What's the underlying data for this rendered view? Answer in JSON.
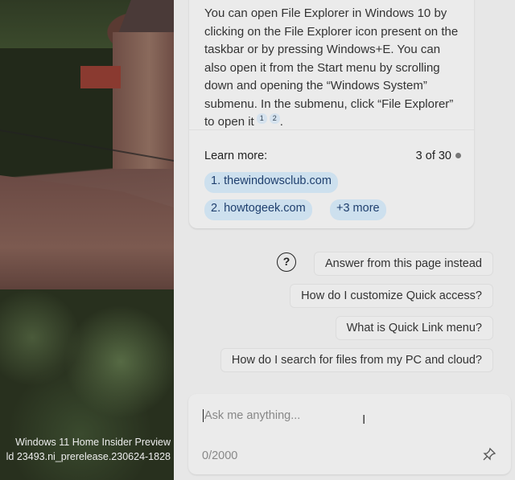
{
  "desktop": {
    "watermark_line1": "Windows 11 Home Insider Preview",
    "watermark_line2": "ld 23493.ni_prerelease.230624-1828"
  },
  "answer": {
    "text": "You can open File Explorer in Windows 10 by clicking on the File Explorer icon present on the taskbar or by pressing Windows+E. You can also open it from the Start menu by scrolling down and opening the “Windows System” submenu. In the submenu, click “File Explorer” to open it",
    "citations": [
      "1",
      "2"
    ],
    "end": ".",
    "learn_more_label": "Learn more:",
    "response_count": "3 of 30",
    "sources": [
      "1. thewindowsclub.com",
      "2. howtogeek.com"
    ],
    "more_sources": "+3 more"
  },
  "suggestions": [
    "Answer from this page instead",
    "How do I customize Quick access?",
    "What is Quick Link menu?",
    "How do I search for files from my PC and cloud?"
  ],
  "question_icon": "?",
  "input": {
    "placeholder": "Ask me anything...",
    "counter": "0/2000",
    "cursor_icon": "I",
    "pin_icon": "📌"
  }
}
